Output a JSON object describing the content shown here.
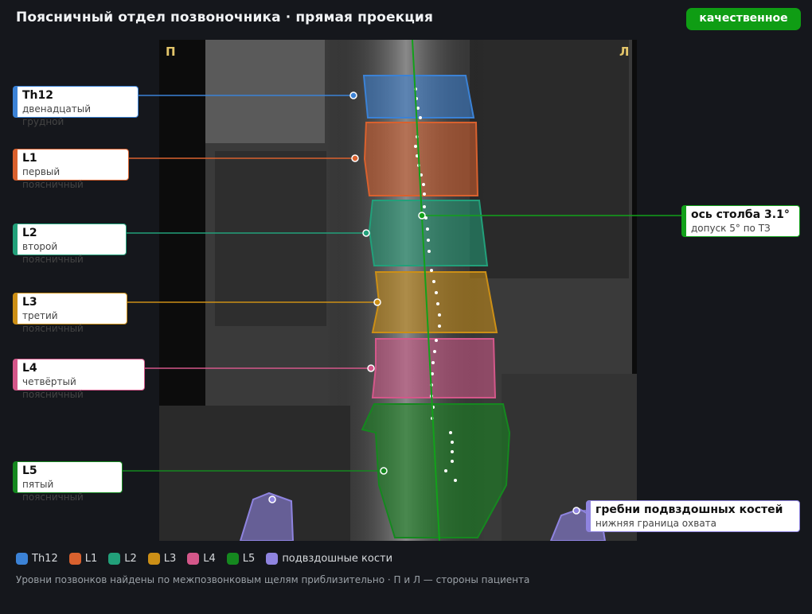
{
  "title": "Поясничный отдел позвоночника · прямая проекция",
  "badge": "качественное",
  "sides": {
    "left": "П",
    "right": "Л"
  },
  "labels": {
    "th12": {
      "name": "Th12",
      "desc": "двенадцатый грудной",
      "color": "#3b82d6"
    },
    "l1": {
      "name": "L1",
      "desc": "первый поясничный",
      "color": "#d9612e"
    },
    "l2": {
      "name": "L2",
      "desc": "второй поясничный",
      "color": "#22a07a"
    },
    "l3": {
      "name": "L3",
      "desc": "третий поясничный",
      "color": "#cc8f16"
    },
    "l4": {
      "name": "L4",
      "desc": "четвёртый поясничный",
      "color": "#d4578a"
    },
    "l5": {
      "name": "L5",
      "desc": "пятый поясничный",
      "color": "#15881f"
    },
    "axis": {
      "name": "ось столба 3.1°",
      "desc": "допуск 5° по ТЗ",
      "color": "#12a11a"
    },
    "iliac": {
      "name": "гребни подвздошных костей",
      "desc": "нижняя граница охвата",
      "color": "#8f84e0"
    }
  },
  "legend": [
    {
      "label": "Th12",
      "color": "#3b82d6"
    },
    {
      "label": "L1",
      "color": "#d9612e"
    },
    {
      "label": "L2",
      "color": "#22a07a"
    },
    {
      "label": "L3",
      "color": "#cc8f16"
    },
    {
      "label": "L4",
      "color": "#d4578a"
    },
    {
      "label": "L5",
      "color": "#15881f"
    },
    {
      "label": "подвздошные кости",
      "color": "#8f84e0"
    }
  ],
  "footnote": "Уровни позвонков найдены по межпозвонковым щелям приблизительно · П и Л — стороны пациента"
}
